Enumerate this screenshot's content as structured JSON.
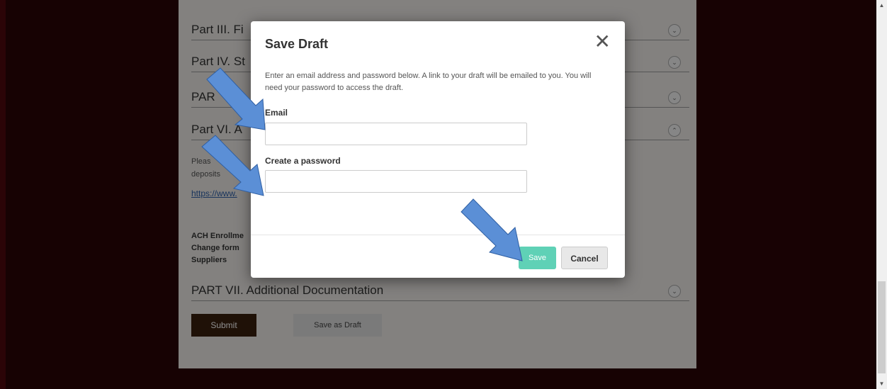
{
  "page": {
    "sections": [
      {
        "id": "part-iii",
        "title": "Part III. Fi",
        "toggle": "⌄"
      },
      {
        "id": "part-iv",
        "title": "Part IV. St",
        "toggle": "⌄"
      },
      {
        "id": "part-v",
        "title": "PAR",
        "toggle": "⌄"
      },
      {
        "id": "part-vi",
        "title": "Part VI. A",
        "toggle": "⌃"
      }
    ],
    "part_vi_text_line1": "Pleas",
    "part_vi_text_line2": "deposits",
    "part_vi_link": "https://www.",
    "ach_line1": "ACH Enrollme",
    "ach_line2": "Change form",
    "ach_line3": "Suppliers",
    "part_vii_title": "PART VII. Additional Documentation",
    "part_vii_toggle": "⌄",
    "submit_label": "Submit",
    "save_as_draft_label": "Save as Draft"
  },
  "modal": {
    "title": "Save Draft",
    "close_symbol": "✕",
    "description": "Enter an email address and password below. A link to your draft will be emailed to you. You will need your password to access the draft.",
    "email_label": "Email",
    "email_value": "",
    "password_label": "Create a password",
    "password_value": "",
    "save_label": "Save",
    "cancel_label": "Cancel"
  },
  "scrollbar": {
    "up_arrow": "▲",
    "down_arrow": "▼"
  },
  "colors": {
    "accent": "#5b8fd6",
    "save_button": "#5fd1b6",
    "submit_button": "#3a1f0d",
    "background": "#2b0407"
  }
}
